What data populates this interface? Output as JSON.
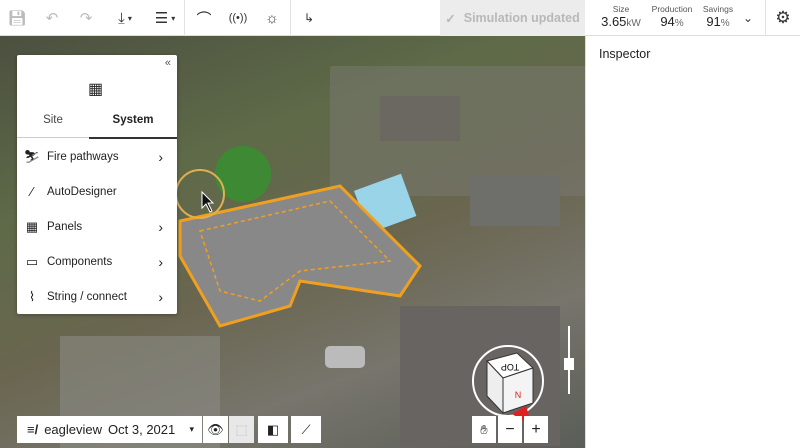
{
  "toolbar": {
    "save_icon": "save-icon",
    "undo_icon": "undo-icon",
    "redo_icon": "redo-icon",
    "download_icon": "download-icon",
    "layers_icon": "layers-icon",
    "arc_icon": "arc-icon",
    "signal_icon": "signal-icon",
    "sun_icon": "sun-icon",
    "string_icon": "string-icon",
    "simulation_status": "Simulation updated"
  },
  "stats": {
    "size": {
      "label": "Size",
      "value": "3.65",
      "unit": "kW"
    },
    "production": {
      "label": "Production",
      "value": "94",
      "unit": "%"
    },
    "savings": {
      "label": "Savings",
      "value": "91",
      "unit": "%"
    }
  },
  "inspector": {
    "title": "Inspector"
  },
  "panel": {
    "tabs": [
      {
        "label": "Site"
      },
      {
        "label": "System"
      }
    ],
    "active_tab": "System",
    "items": [
      {
        "label": "Fire pathways",
        "icon": "fire-pathway-icon",
        "has_submenu": true
      },
      {
        "label": "AutoDesigner",
        "icon": "magic-wand-icon",
        "has_submenu": false
      },
      {
        "label": "Panels",
        "icon": "panels-icon",
        "has_submenu": true
      },
      {
        "label": "Components",
        "icon": "component-icon",
        "has_submenu": true
      },
      {
        "label": "String / connect",
        "icon": "string-icon",
        "has_submenu": true
      }
    ]
  },
  "imagery": {
    "provider": "eagleview",
    "date": "Oct 3, 2021"
  },
  "navcube": {
    "top_label": "TOP",
    "north_label": "N"
  },
  "colors": {
    "accent": "#f0a020",
    "sim_bg": "#ececec"
  }
}
